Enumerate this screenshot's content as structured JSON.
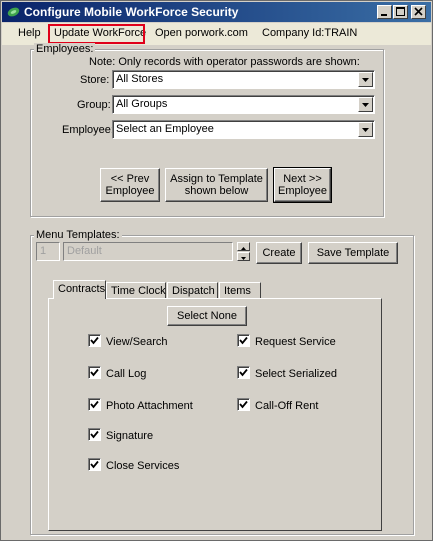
{
  "window": {
    "title": "Configure Mobile WorkForce Security"
  },
  "menu": {
    "help": "Help",
    "update_workforce": "Update WorkForce",
    "open_porwork": "Open porwork.com",
    "company_id": "Company Id:TRAIN"
  },
  "employees": {
    "group_label": "Employees:",
    "note": "Note: Only records with operator passwords are shown:",
    "store_label": "Store:",
    "store_value": "All Stores",
    "group_field_label": "Group:",
    "group_value": "All Groups",
    "employee_label": "Employee:",
    "employee_value": "Select an Employee",
    "prev_button": "<< Prev\nEmployee",
    "assign_button": "Assign to Template\nshown below",
    "next_button": "Next >>\nEmployee"
  },
  "templates": {
    "group_label": "Menu Templates:",
    "number_value": "1",
    "name_value": "Default",
    "create_button": "Create",
    "save_button": "Save Template"
  },
  "tabs": [
    "Contracts",
    "Time Clock",
    "Dispatch",
    "Items"
  ],
  "select_none_button": "Select None",
  "permissions": [
    {
      "label": "View/Search",
      "checked": true
    },
    {
      "label": "Call Log",
      "checked": true
    },
    {
      "label": "Photo Attachment",
      "checked": true
    },
    {
      "label": "Signature",
      "checked": true
    },
    {
      "label": "Close Services",
      "checked": true
    },
    {
      "label": "Request Service",
      "checked": true
    },
    {
      "label": "Select Serialized",
      "checked": true
    },
    {
      "label": "Call-Off Rent",
      "checked": true
    }
  ],
  "colors": {
    "titlebar_start": "#0a246a",
    "titlebar_end": "#3a6ea5",
    "highlight": "#e0001a",
    "face": "#d4d0c8"
  }
}
